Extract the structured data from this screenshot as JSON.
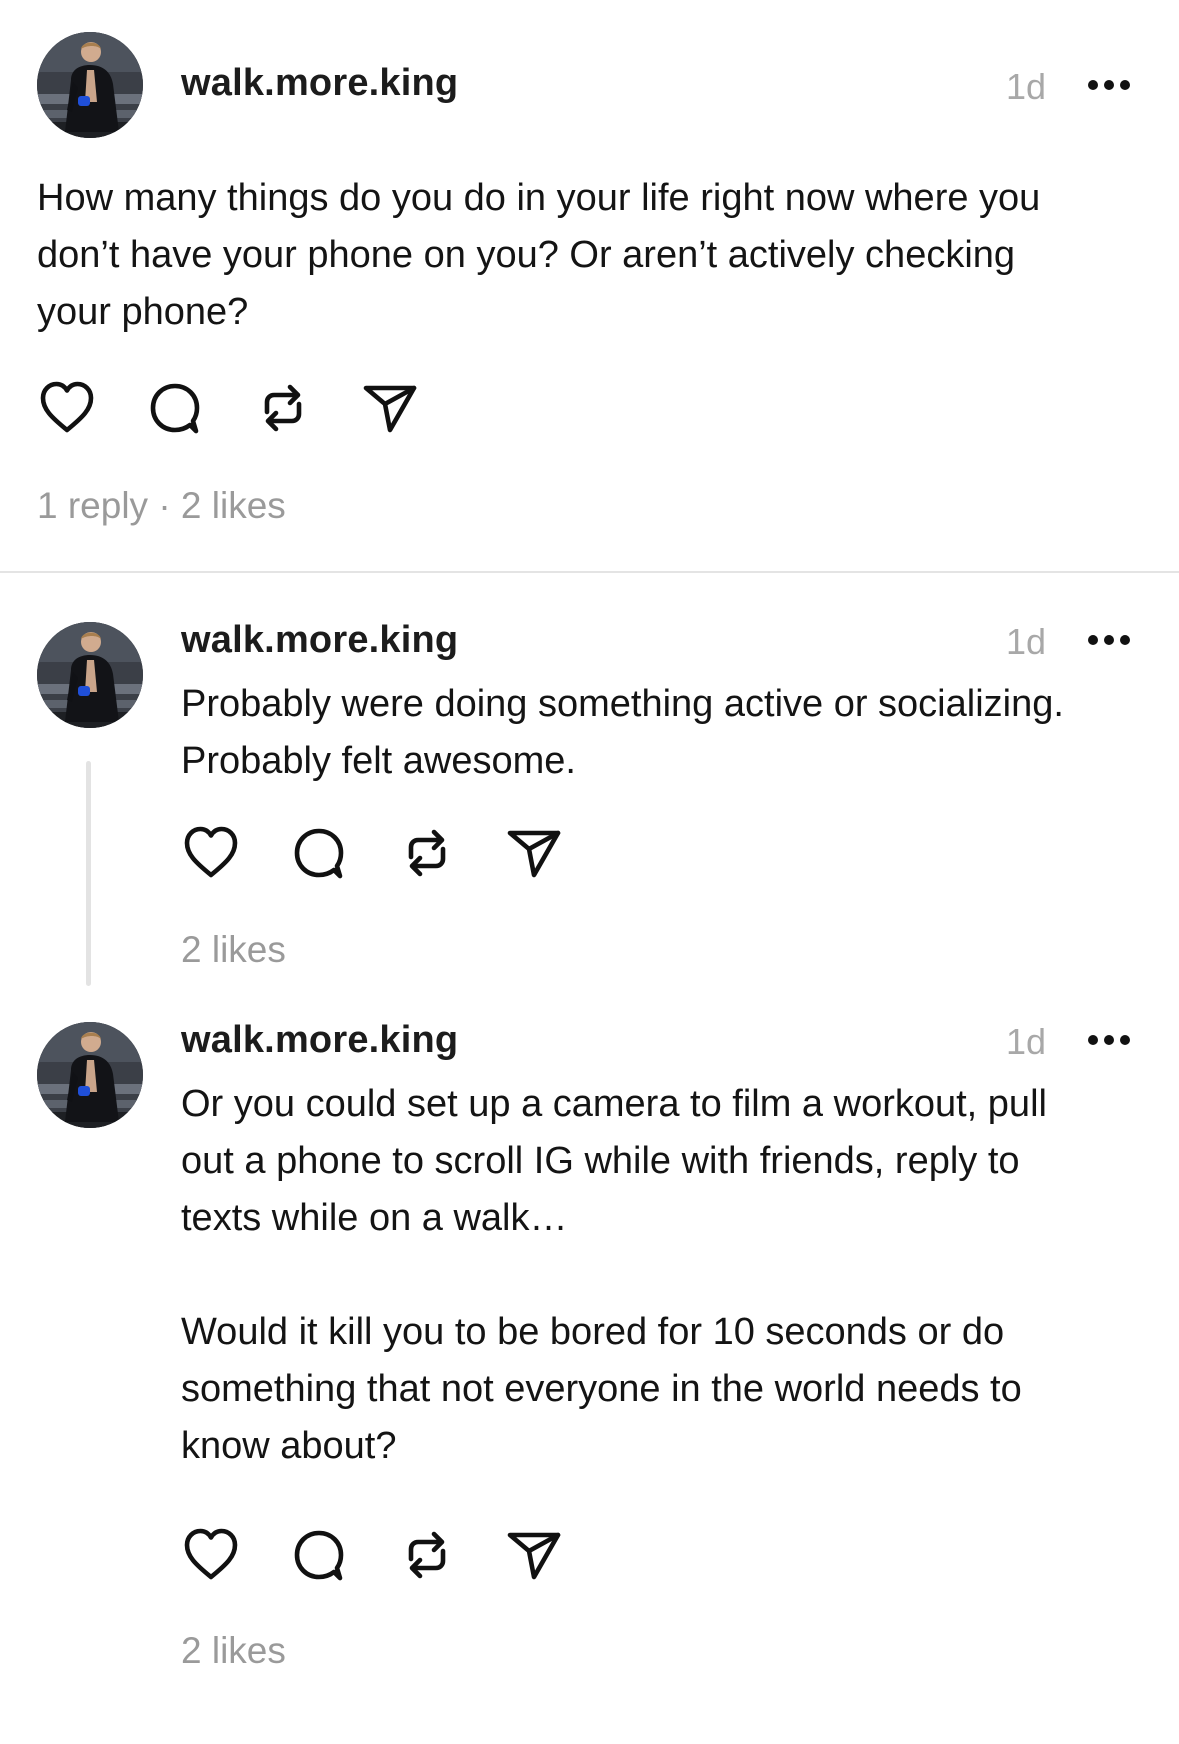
{
  "posts": [
    {
      "username": "walk.more.king",
      "time": "1d",
      "text": "How many things do you do in your life right now where you\ndon’t have your phone on you? Or aren’t actively checking\nyour phone?",
      "stats": "1 reply · 2 likes"
    },
    {
      "username": "walk.more.king",
      "time": "1d",
      "text": "Probably were doing something active or socializing.\nProbably felt awesome.",
      "stats": "2 likes"
    },
    {
      "username": "walk.more.king",
      "time": "1d",
      "text": "Or you could set up a camera to film a workout, pull\nout a phone to scroll IG while with friends, reply to\ntexts while on a walk…\n\nWould it kill you to be bored for 10 seconds or do\nsomething that not everyone in the world needs to\nknow about?",
      "stats": "2 likes"
    }
  ],
  "icons": {
    "like": "heart-icon",
    "reply": "comment-bubble-icon",
    "repost": "repost-icon",
    "share": "send-icon",
    "more": "more-horizontal-icon"
  },
  "colors": {
    "text": "#141414",
    "muted": "#9a9a9a",
    "divider": "#e4e4e4"
  }
}
